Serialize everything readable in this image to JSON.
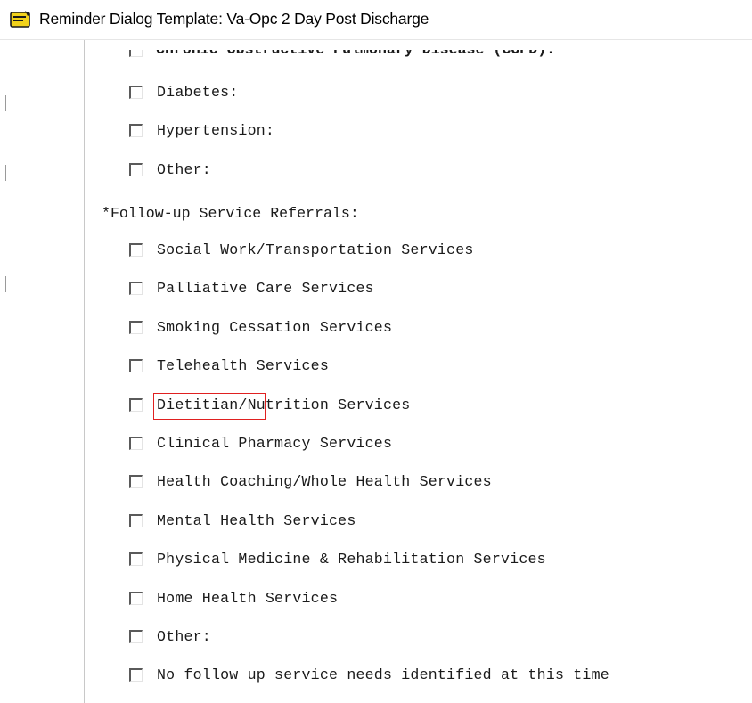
{
  "window": {
    "title": "Reminder Dialog Template: Va-Opc 2 Day Post Discharge"
  },
  "partial_item": {
    "label": "Chronic Obstructive Pulmonary Disease (COPD):"
  },
  "conditions": {
    "items": [
      {
        "label": "Diabetes:"
      },
      {
        "label": "Hypertension:"
      },
      {
        "label": "Other:"
      }
    ]
  },
  "referrals": {
    "header": "*Follow-up Service Referrals:",
    "items": [
      {
        "label": "Social Work/Transportation Services"
      },
      {
        "label": "Palliative Care Services"
      },
      {
        "label": "Smoking Cessation Services"
      },
      {
        "label": "Telehealth Services"
      },
      {
        "label": "Dietitian/Nutrition Services"
      },
      {
        "label": "Clinical Pharmacy Services"
      },
      {
        "label": "Health Coaching/Whole Health Services"
      },
      {
        "label": "Mental Health Services"
      },
      {
        "label": "Physical Medicine & Rehabilitation Services"
      },
      {
        "label": "Home Health Services"
      },
      {
        "label": "Other:"
      },
      {
        "label": "No follow up service needs identified at this time"
      }
    ]
  },
  "highlight": {
    "text": "Dietitian",
    "color": "#e02020"
  },
  "icons": {
    "app": "reminder-dialog-icon",
    "checkbox": "checkbox-unchecked-icon"
  }
}
